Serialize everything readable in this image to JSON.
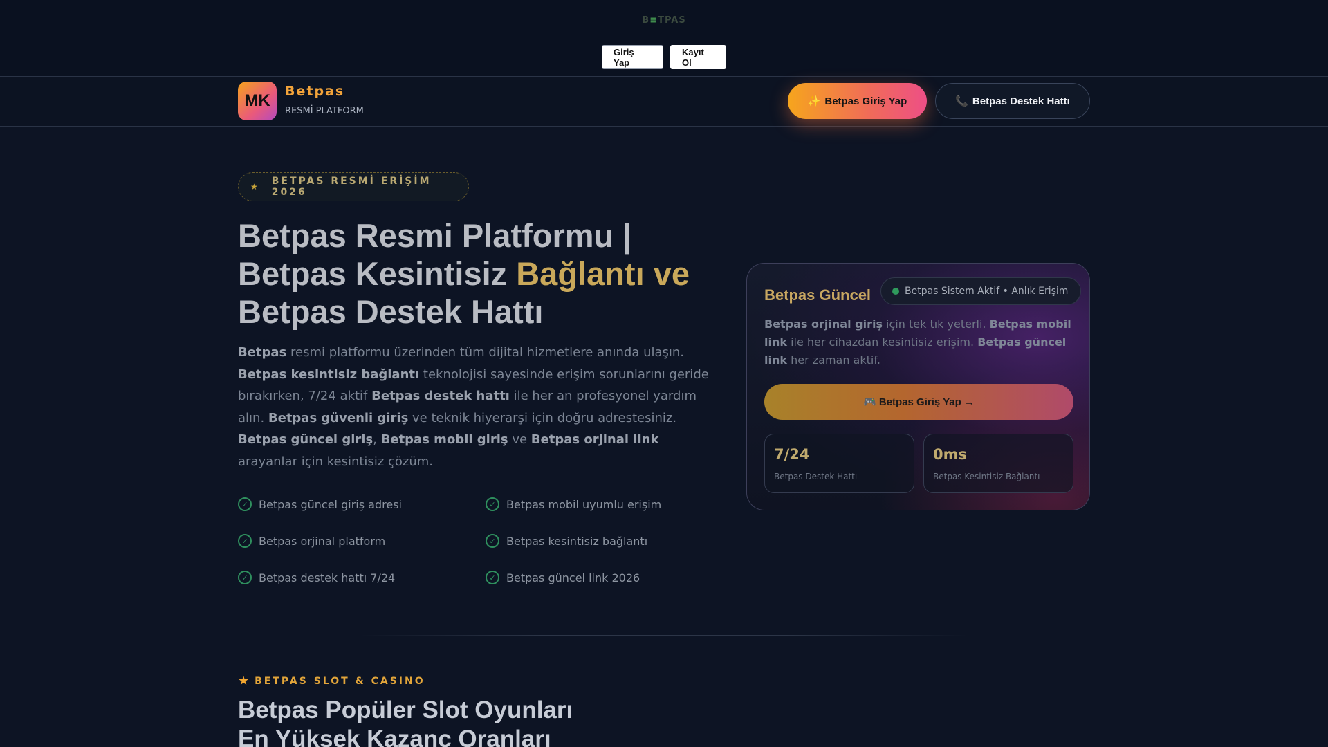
{
  "topbar": {
    "brand_prefix": "B",
    "brand_mid": "≡",
    "brand_suffix": "TPAS",
    "login_label": "Giriş Yap",
    "register_label": "Kayıt Ol"
  },
  "header": {
    "logo_initials": "MK",
    "name": "Betpas",
    "subtitle": "RESMİ PLATFORM",
    "login_icon": "✨",
    "login_label": "Betpas Giriş Yap",
    "support_icon": "📞",
    "support_label": "Betpas Destek Hattı"
  },
  "hero": {
    "badge_icon": "★",
    "badge_text": "BETPAS RESMİ ERİŞİM 2026",
    "title_part1": "Betpas Resmi Platformu |",
    "title_part2a": "Betpas Kesintisiz ",
    "title_part2b": "Bağlantı ve",
    "title_part3": "Betpas Destek Hattı",
    "desc": {
      "b1": "Betpas",
      "t1": " resmi platformu üzerinden tüm dijital hizmetlere anında ulaşın. ",
      "b2": "Betpas kesintisiz bağlantı",
      "t2": " teknolojisi sayesinde erişim sorunlarını geride bırakırken, 7/24 aktif ",
      "b3": "Betpas destek hattı",
      "t3": " ile her an profesyonel yardım alın. ",
      "b4": "Betpas güvenli giriş",
      "t4": " ve teknik hiyerarşi için doğru adrestesiniz. ",
      "b5": "Betpas güncel giriş",
      "t5": ", ",
      "b6": "Betpas mobil giriş",
      "t6": " ve ",
      "b7": "Betpas orjinal link",
      "t7": " arayanlar için kesintisiz çözüm."
    },
    "features": [
      "Betpas güncel giriş adresi",
      "Betpas mobil uyumlu erişim",
      "Betpas orjinal platform",
      "Betpas kesintisiz bağlantı",
      "Betpas destek hattı 7/24",
      "Betpas güncel link 2026"
    ],
    "check_icon": "✓"
  },
  "card": {
    "title": "Betpas Güncel",
    "status_text": "Betpas Sistem Aktif • Anlık Erişim",
    "status_color": "#2f9a5c",
    "desc": {
      "b1": "Betpas orjinal giriş",
      "t1": " için tek tık yeterli. ",
      "b2": "Betpas mobil link",
      "t2": " ile her cihazdan kesintisiz erişim. ",
      "b3": "Betpas güncel link",
      "t3": " her zaman aktif."
    },
    "cta_label": "🎮 Betpas Giriş Yap →",
    "stats": [
      {
        "value": "7/24",
        "label": "Betpas Destek Hattı"
      },
      {
        "value": "0ms",
        "label": "Betpas Kesintisiz Bağlantı"
      }
    ]
  },
  "section": {
    "tag_icon": "★",
    "tag_text": "BETPAS SLOT & CASINO",
    "title_line1": "Betpas Popüler Slot Oyunları",
    "title_line2": "En Yüksek Kazanç Oranları"
  },
  "colors": {
    "accent_orange": "#f6a51d",
    "accent_pink": "#ee4f86",
    "gold_text": "#c9a85a",
    "success_green": "#2f8f5e",
    "background": "#0d1424"
  }
}
